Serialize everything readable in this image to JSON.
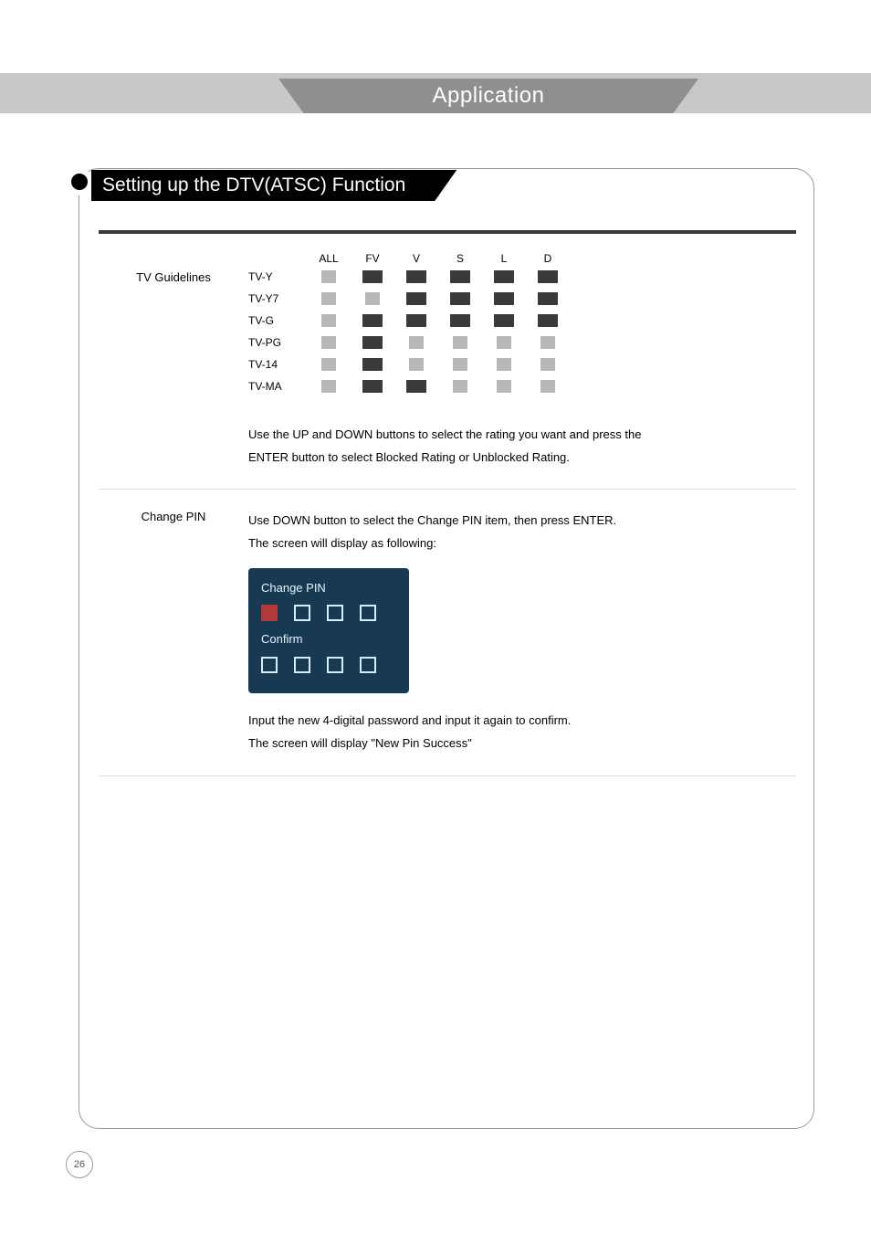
{
  "tab_title": "Application",
  "section_title": "Setting up the DTV(ATSC) Function",
  "tv_guidelines": {
    "label": "TV Guidelines",
    "columns": [
      "ALL",
      "FV",
      "V",
      "S",
      "L",
      "D"
    ],
    "rows": [
      {
        "name": "TV-Y",
        "states": [
          "gray",
          "dark",
          "dark",
          "dark",
          "dark",
          "dark"
        ]
      },
      {
        "name": "TV-Y7",
        "states": [
          "gray",
          "gray",
          "dark",
          "dark",
          "dark",
          "dark"
        ]
      },
      {
        "name": "TV-G",
        "states": [
          "gray",
          "dark",
          "dark",
          "dark",
          "dark",
          "dark"
        ]
      },
      {
        "name": "TV-PG",
        "states": [
          "gray",
          "dark",
          "gray",
          "gray",
          "gray",
          "gray"
        ]
      },
      {
        "name": "TV-14",
        "states": [
          "gray",
          "dark",
          "gray",
          "gray",
          "gray",
          "gray"
        ]
      },
      {
        "name": "TV-MA",
        "states": [
          "gray",
          "dark",
          "dark",
          "gray",
          "gray",
          "gray"
        ]
      }
    ],
    "instruction_line1": "Use the UP and DOWN buttons to select the rating you want and press the",
    "instruction_line2": "ENTER button to select Blocked Rating or Unblocked Rating."
  },
  "change_pin": {
    "label": "Change PIN",
    "line1": "Use DOWN button to select the Change PIN item, then press ENTER.",
    "line2": "The screen will display as following:",
    "panel_title": "Change PIN",
    "panel_confirm": "Confirm",
    "after_line1": "Input the new 4-digital password and input it again to confirm.",
    "after_line2": "The screen will display \"New Pin Success\""
  },
  "page_number": "26"
}
